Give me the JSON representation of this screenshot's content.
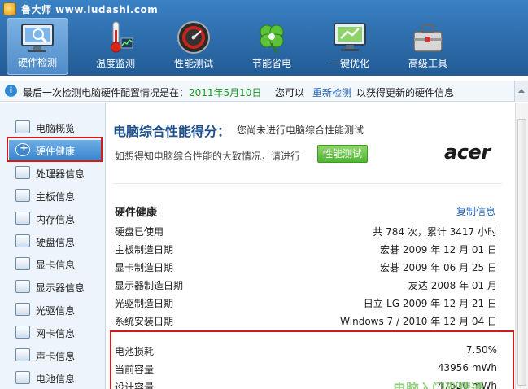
{
  "app": {
    "title": "鲁大师 www.ludashi.com"
  },
  "toolbar": {
    "items": [
      {
        "label": "硬件检测",
        "icon": "monitor-magnifier-icon"
      },
      {
        "label": "温度监测",
        "icon": "thermometer-icon"
      },
      {
        "label": "性能测试",
        "icon": "speedometer-icon"
      },
      {
        "label": "节能省电",
        "icon": "clover-icon"
      },
      {
        "label": "一键优化",
        "icon": "monitor-optimize-icon"
      },
      {
        "label": "高级工具",
        "icon": "toolbox-icon"
      }
    ],
    "active_index": 0
  },
  "infobar": {
    "prefix": "最后一次检测电脑硬件配置情况是在：",
    "date": "2011年5月10日",
    "mid": "您可以",
    "link": "重新检测",
    "suffix": "以获得更新的硬件信息"
  },
  "sidebar": {
    "items": [
      "电脑概览",
      "硬件健康",
      "处理器信息",
      "主板信息",
      "内存信息",
      "硬盘信息",
      "显卡信息",
      "显示器信息",
      "光驱信息",
      "网卡信息",
      "声卡信息",
      "电池信息"
    ],
    "selected_index": 1
  },
  "main": {
    "score_title": "电脑综合性能得分：",
    "score_note": "您尚未进行电脑综合性能测试",
    "hint": "如想得知电脑综合性能的大致情况，请进行",
    "perf_button": "性能测试",
    "brand": "acer",
    "section_title": "硬件健康",
    "copy_link": "复制信息",
    "rows": [
      {
        "k": "硬盘已使用",
        "v": "共 784 次，累计 3417 小时"
      },
      {
        "k": "主板制造日期",
        "v": "宏碁 2009 年 12 月 01 日"
      },
      {
        "k": "显卡制造日期",
        "v": "宏碁 2009 年 06 月 25 日"
      },
      {
        "k": "显示器制造日期",
        "v": "友达 2008 年 01 月"
      },
      {
        "k": "光驱制造日期",
        "v": "日立-LG 2009 年 12 月 21 日"
      },
      {
        "k": "系统安装日期",
        "v": "Windows 7 / 2010 年 12 月 04 日"
      },
      {
        "k": "电池损耗",
        "v": "7.50%"
      },
      {
        "k": "当前容量",
        "v": "43956 mWh"
      },
      {
        "k": "设计容量",
        "v": "47520 mWh"
      }
    ]
  },
  "watermark": "电脑入门到精通",
  "colors": {
    "header": "#2f6fae",
    "highlight": "#d21a1a",
    "accent_green": "#199a25",
    "link_blue": "#1f5fb0"
  }
}
